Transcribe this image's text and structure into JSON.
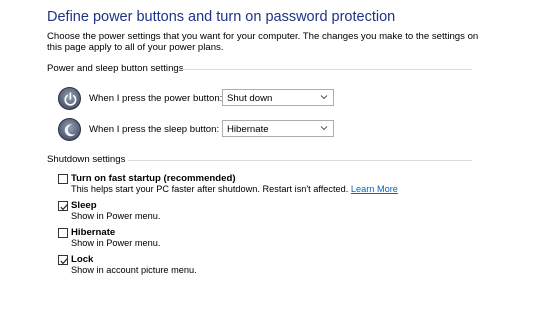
{
  "page": {
    "title": "Define power buttons and turn on password protection",
    "description": "Choose the power settings that you want for your computer. The changes you make to the settings on this page apply to all of your power plans."
  },
  "power_section": {
    "label": "Power and sleep button settings",
    "power_button": {
      "label": "When I press the power button:",
      "value": "Shut down",
      "icon": "power-icon"
    },
    "sleep_button": {
      "label": "When I press the sleep button:",
      "value": "Hibernate",
      "icon": "moon-icon"
    }
  },
  "shutdown_section": {
    "label": "Shutdown settings",
    "items": [
      {
        "label": "Turn on fast startup (recommended)",
        "checked": false,
        "help": "This helps start your PC faster after shutdown. Restart isn't affected.",
        "link": "Learn More"
      },
      {
        "label": "Sleep",
        "checked": true,
        "help": "Show in Power menu."
      },
      {
        "label": "Hibernate",
        "checked": false,
        "help": "Show in Power menu."
      },
      {
        "label": "Lock",
        "checked": true,
        "help": "Show in account picture menu."
      }
    ]
  },
  "colors": {
    "title": "#1e3287",
    "link": "#0066cc"
  }
}
